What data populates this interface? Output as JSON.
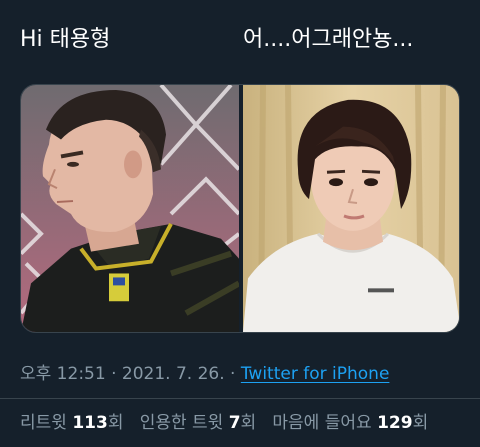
{
  "tweet": {
    "caption_left": "Hi 태용형",
    "caption_right": "어....어그래안뇽...",
    "time": "오후 12:51",
    "sep1": " · ",
    "date": "2021. 7. 26.",
    "sep2": " · ",
    "source": "Twitter for iPhone"
  },
  "stats": {
    "retweets": {
      "label": "리트윗 ",
      "count": "113",
      "unit": "회"
    },
    "quotes": {
      "label": "인용한 트윗 ",
      "count": "7",
      "unit": "회"
    },
    "likes": {
      "label": "마음에 들어요 ",
      "count": "129",
      "unit": "회"
    }
  },
  "colors": {
    "background": "#15202b",
    "text_primary": "#ffffff",
    "text_secondary": "#8899a6",
    "link": "#1da1f2",
    "border": "#38444d"
  }
}
